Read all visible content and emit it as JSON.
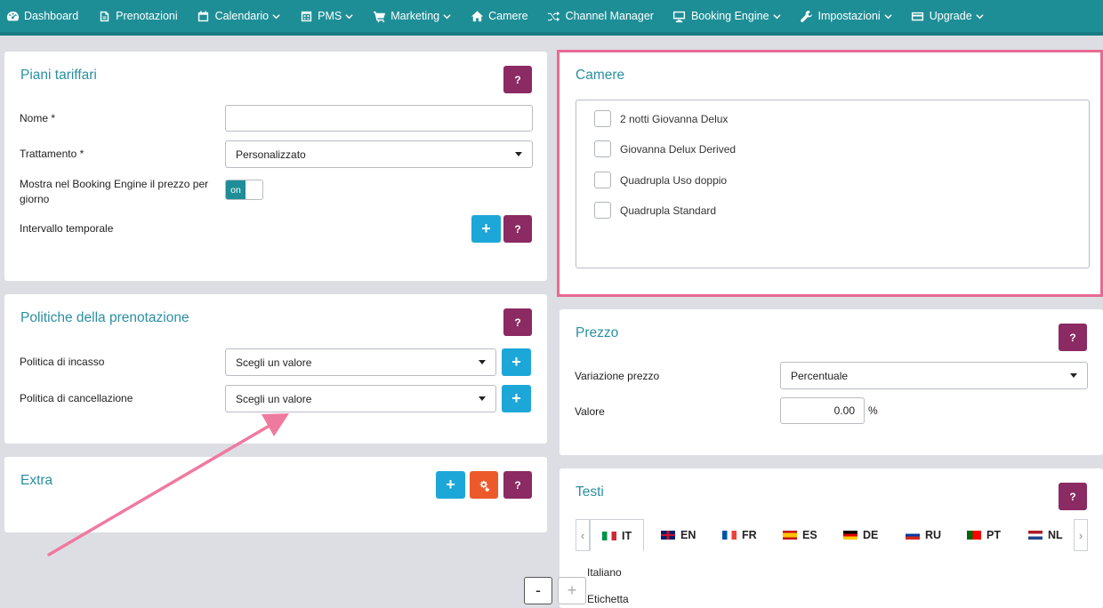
{
  "nav": [
    {
      "label": "Dashboard",
      "icon": "dashboard-icon",
      "dropdown": false
    },
    {
      "label": "Prenotazioni",
      "icon": "bookings-icon",
      "dropdown": false
    },
    {
      "label": "Calendario",
      "icon": "calendar-icon",
      "dropdown": true
    },
    {
      "label": "PMS",
      "icon": "pms-icon",
      "dropdown": true
    },
    {
      "label": "Marketing",
      "icon": "cart-icon",
      "dropdown": true
    },
    {
      "label": "Camere",
      "icon": "home-icon",
      "dropdown": false
    },
    {
      "label": "Channel Manager",
      "icon": "shuffle-icon",
      "dropdown": false
    },
    {
      "label": "Booking Engine",
      "icon": "monitor-icon",
      "dropdown": true
    },
    {
      "label": "Impostazioni",
      "icon": "wrench-icon",
      "dropdown": true
    },
    {
      "label": "Upgrade",
      "icon": "card-icon",
      "dropdown": true
    }
  ],
  "help_label": "?",
  "plus_label": "+",
  "rate_plans": {
    "title": "Piani tariffari",
    "name_label": "Nome *",
    "name_value": "",
    "treatment_label": "Trattamento *",
    "treatment_value": "Personalizzato",
    "show_price_label": "Mostra nel Booking Engine il prezzo per giorno",
    "toggle_label": "on",
    "interval_label": "Intervallo temporale"
  },
  "policies": {
    "title": "Politiche della prenotazione",
    "collection_label": "Politica di incasso",
    "collection_value": "Scegli un valore",
    "cancel_label": "Politica di cancellazione",
    "cancel_value": "Scegli un valore"
  },
  "extra": {
    "title": "Extra"
  },
  "rooms": {
    "title": "Camere",
    "items": [
      "2 notti Giovanna Delux",
      "Giovanna Delux Derived",
      "Quadrupla Uso doppio",
      "Quadrupla Standard"
    ]
  },
  "price": {
    "title": "Prezzo",
    "variation_label": "Variazione prezzo",
    "variation_value": "Percentuale",
    "value_label": "Valore",
    "value_value": "0.00",
    "unit": "%"
  },
  "texts": {
    "title": "Testi",
    "tabs": [
      "IT",
      "EN",
      "FR",
      "ES",
      "DE",
      "RU",
      "PT",
      "NL"
    ],
    "language_label": "Italiano",
    "label_field": "Etichetta"
  },
  "zoom": {
    "minus": "-",
    "plus": "+"
  },
  "colors": {
    "nav": "#1e8e96",
    "help": "#8b2a63",
    "plus": "#1da7d8",
    "orange": "#ec5a2b",
    "highlight": "#e86a93"
  }
}
